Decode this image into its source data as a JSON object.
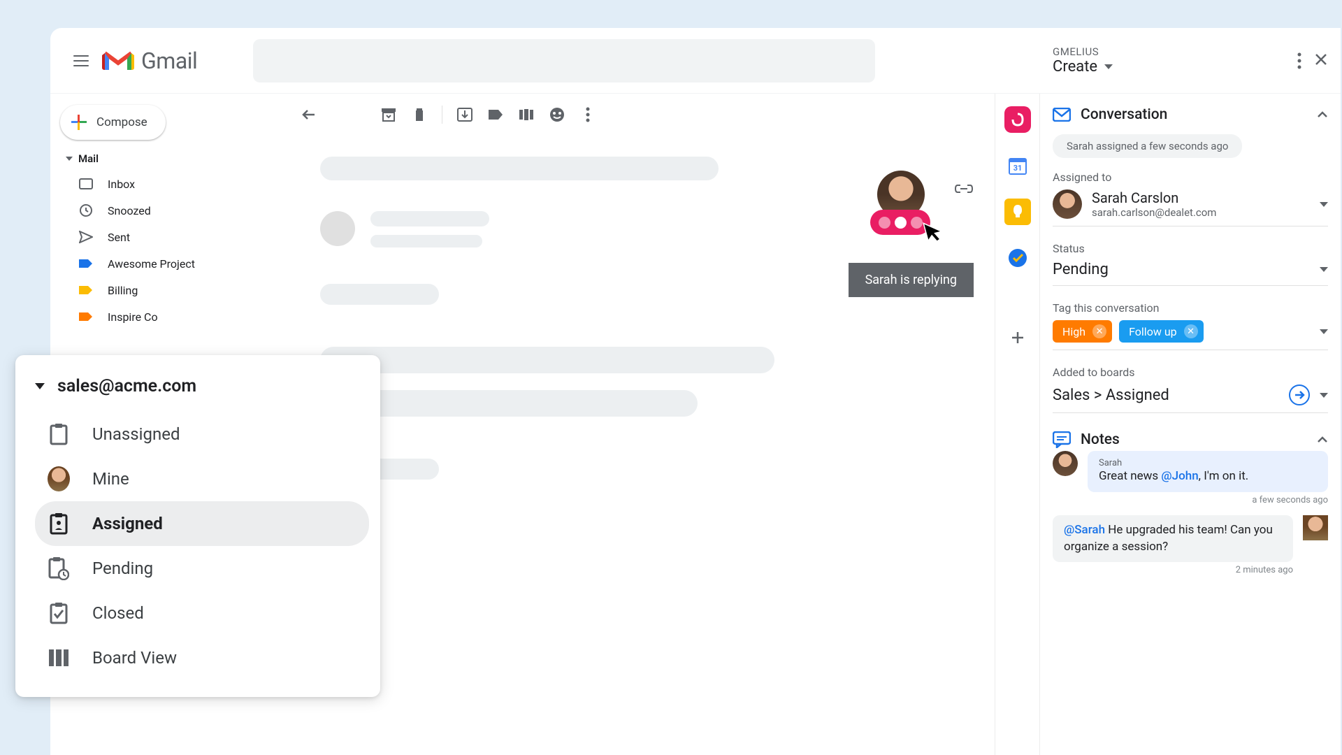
{
  "header": {
    "app_name": "Gmail"
  },
  "compose_label": "Compose",
  "nav_section": "Mail",
  "nav_items": [
    {
      "label": "Inbox"
    },
    {
      "label": "Snoozed"
    },
    {
      "label": "Sent"
    },
    {
      "label": "Awesome Project"
    },
    {
      "label": "Billing"
    },
    {
      "label": "Inspire Co"
    }
  ],
  "shared_inbox": {
    "title": "sales@acme.com",
    "items": [
      {
        "label": "Unassigned"
      },
      {
        "label": "Mine"
      },
      {
        "label": "Assigned"
      },
      {
        "label": "Pending"
      },
      {
        "label": "Closed"
      },
      {
        "label": "Board View"
      }
    ]
  },
  "tooltip": "Sarah is replying",
  "gmelius": {
    "brand": "GMELIUS",
    "create": "Create",
    "conversation_label": "Conversation",
    "assigned_pill": "Sarah assigned a few seconds ago",
    "assigned_to_label": "Assigned to",
    "assignee_name": "Sarah Carslon",
    "assignee_email": "sarah.carlson@dealet.com",
    "status_label": "Status",
    "status_value": "Pending",
    "tags_label": "Tag this conversation",
    "tags": [
      {
        "label": "High",
        "color": "#ff7b00"
      },
      {
        "label": "Follow up",
        "color": "#1a9cf0"
      }
    ],
    "boards_label": "Added to boards",
    "boards_value": "Sales > Assigned",
    "notes_label": "Notes",
    "notes": [
      {
        "author": "Sarah",
        "text_pre": "Great news ",
        "mention": "@John",
        "text_post": ", I'm on it.",
        "time": "a few seconds ago"
      },
      {
        "mention": "@Sarah",
        "text_post": " He upgraded his team! Can you organize a session?",
        "time": "2 minutes ago"
      }
    ]
  }
}
